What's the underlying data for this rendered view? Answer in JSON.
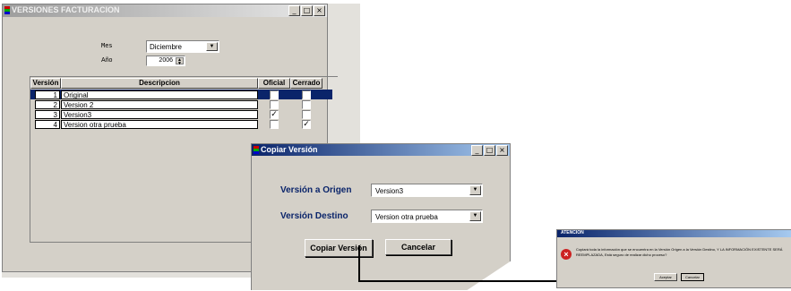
{
  "main_window": {
    "title": "VERSIONES FACTURACION",
    "mes_label": "Mes",
    "mes_value": "Diciembre",
    "anio_label": "Año",
    "anio_value": "2006",
    "columns": [
      "Versión",
      "Descripcion",
      "Oficial",
      "Cerrado"
    ],
    "rows": [
      {
        "version": "1",
        "descripcion": "Original",
        "oficial": false,
        "cerrado": false,
        "selected": true
      },
      {
        "version": "2",
        "descripcion": "Version 2",
        "oficial": false,
        "cerrado": false,
        "selected": false
      },
      {
        "version": "3",
        "descripcion": "Version3",
        "oficial": true,
        "cerrado": false,
        "selected": false
      },
      {
        "version": "4",
        "descripcion": "Version otra prueba",
        "oficial": false,
        "cerrado": true,
        "selected": false
      }
    ]
  },
  "copy_dialog": {
    "title": "Copiar Versión",
    "origen_label": "Versión a Origen",
    "origen_value": "Version3",
    "destino_label": "Versión Destino",
    "destino_value": "Version otra prueba",
    "copy_button": "Copiar Versión",
    "cancel_button": "Cancelar"
  },
  "alert_dialog": {
    "title": "ATENCION",
    "message": "Copiará toda la información que se encuentra en la Versión Origen a la Versión Destino, Y LA INFORMACIÓN EXISTENTE SERÁ REEMPLAZADA, Está seguro de realizar dicho proceso?",
    "ok_button": "Aceptar",
    "cancel_button": "Cancelar"
  },
  "colors": {
    "face": "#d4d0c8",
    "titlebar_inactive": "#9d9d9d",
    "titlebar_active": "#0a246a",
    "selection": "#0a246a",
    "error_red": "#cc2222"
  }
}
